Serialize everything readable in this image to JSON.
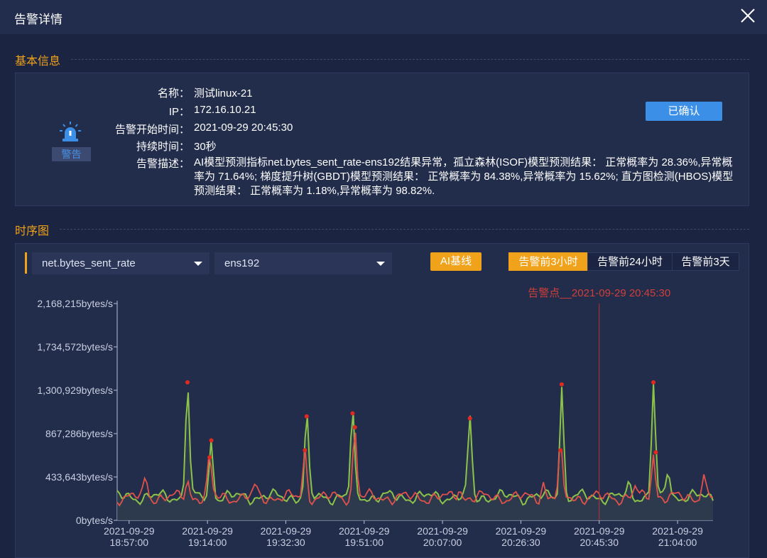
{
  "dialog": {
    "title": "告警详情",
    "close_icon": "close-icon"
  },
  "basic_info": {
    "section_title": "基本信息",
    "badge": "警告",
    "icon": "alarm-light-icon",
    "fields": [
      {
        "label": "名称：",
        "value": "测试linux-21"
      },
      {
        "label": "IP：",
        "value": "172.16.10.21"
      },
      {
        "label": "告警开始时间：",
        "value": "2021-09-29 20:45:30"
      },
      {
        "label": "持续时间：",
        "value": "30秒"
      }
    ],
    "description_label": "告警描述：",
    "description": "AI模型预测指标net.bytes_sent_rate-ens192结果异常，孤立森林(ISOF)模型预测结果： 正常概率为 28.36%,异常概率为 71.64%; 梯度提升树(GBDT)模型预测结果： 正常概率为 84.38%,异常概率为 15.62%; 直方图检测(HBOS)模型预测结果： 正常概率为 1.18%,异常概率为 98.82%.",
    "confirm_button": "已确认"
  },
  "timeseries": {
    "section_title": "时序图",
    "metric_select": "net.bytes_sent_rate",
    "interface_select": "ens192",
    "ai_button": "AI基线",
    "ranges": [
      "告警前3小时",
      "告警前24小时",
      "告警前3天"
    ],
    "active_range": 0
  },
  "colors": {
    "accent": "#f0a21a",
    "blue": "#3b8fe6",
    "series_green": "#8bc34a",
    "series_red": "#e0524a",
    "alarm_line": "#c0302c"
  },
  "chart_data": {
    "type": "line",
    "y_ticks": [
      "2,168,215bytes/s",
      "1,734,572bytes/s",
      "1,300,929bytes/s",
      "867,286bytes/s",
      "433,643bytes/s",
      "0bytes/s"
    ],
    "y_tick_values": [
      2168215,
      1734572,
      1300929,
      867286,
      433643,
      0
    ],
    "ylim": [
      0,
      2168215
    ],
    "x_ticks": [
      [
        "2021-09-29",
        "18:57:00"
      ],
      [
        "2021-09-29",
        "19:14:00"
      ],
      [
        "2021-09-29",
        "19:32:30"
      ],
      [
        "2021-09-29",
        "19:51:00"
      ],
      [
        "2021-09-29",
        "20:07:00"
      ],
      [
        "2021-09-29",
        "20:26:30"
      ],
      [
        "2021-09-29",
        "20:45:30"
      ],
      [
        "2021-09-29",
        "21:04:00"
      ]
    ],
    "alarm_marker": {
      "label": "告警点__2021-09-29 20:45:30",
      "tick_index": 6
    },
    "series": [
      {
        "color": "#8bc34a",
        "baseline": 235000,
        "peaks": [
          [
            0.118,
            1380000
          ],
          [
            0.158,
            800000
          ],
          [
            0.318,
            1040000
          ],
          [
            0.395,
            1070000
          ],
          [
            0.592,
            1020000
          ],
          [
            0.746,
            1360000
          ],
          [
            0.9,
            1380000
          ],
          [
            0.86,
            350000
          ],
          [
            0.925,
            520000
          ]
        ]
      },
      {
        "color": "#e0524a",
        "baseline": 230000,
        "peaks": [
          [
            0.048,
            420000
          ],
          [
            0.118,
            400000
          ],
          [
            0.155,
            630000
          ],
          [
            0.232,
            330000
          ],
          [
            0.315,
            700000
          ],
          [
            0.399,
            930000
          ],
          [
            0.574,
            330000
          ],
          [
            0.744,
            700000
          ],
          [
            0.9,
            680000
          ],
          [
            0.87,
            330000
          ],
          [
            0.984,
            470000
          ],
          [
            0.715,
            380000
          ]
        ]
      }
    ],
    "anomaly_points": [
      [
        0.118,
        1380000
      ],
      [
        0.158,
        800000
      ],
      [
        0.155,
        630000
      ],
      [
        0.318,
        1040000
      ],
      [
        0.315,
        700000
      ],
      [
        0.395,
        1070000
      ],
      [
        0.399,
        930000
      ],
      [
        0.592,
        1020000
      ],
      [
        0.746,
        1360000
      ],
      [
        0.744,
        700000
      ],
      [
        0.9,
        1380000
      ],
      [
        0.904,
        680000
      ]
    ]
  }
}
